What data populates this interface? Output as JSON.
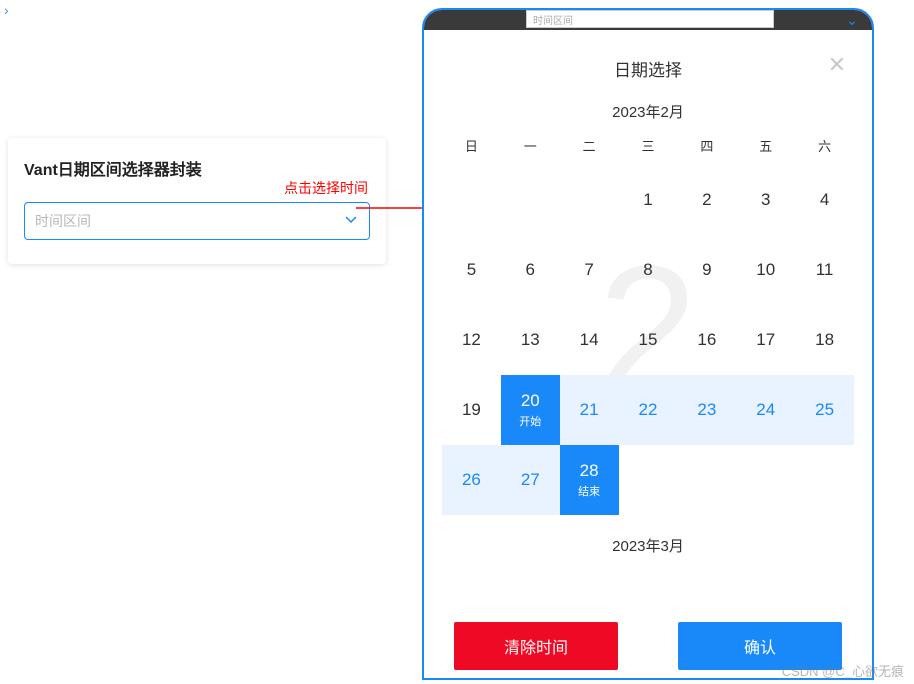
{
  "leftCard": {
    "title": "Vant日期区间选择器封装",
    "inputPlaceholder": "时间区间"
  },
  "annotation": "点击选择时间",
  "darkStrip": {
    "placeholder": "时间区间"
  },
  "calendar": {
    "title": "日期选择",
    "monthLabel": "2023年2月",
    "watermark": "2",
    "weekdays": [
      "日",
      "一",
      "二",
      "三",
      "四",
      "五",
      "六"
    ],
    "days": [
      {
        "n": "",
        "t": "empty"
      },
      {
        "n": "",
        "t": "empty"
      },
      {
        "n": "",
        "t": "empty"
      },
      {
        "n": "1",
        "t": ""
      },
      {
        "n": "2",
        "t": ""
      },
      {
        "n": "3",
        "t": ""
      },
      {
        "n": "4",
        "t": ""
      },
      {
        "n": "5",
        "t": ""
      },
      {
        "n": "6",
        "t": ""
      },
      {
        "n": "7",
        "t": ""
      },
      {
        "n": "8",
        "t": ""
      },
      {
        "n": "9",
        "t": ""
      },
      {
        "n": "10",
        "t": ""
      },
      {
        "n": "11",
        "t": ""
      },
      {
        "n": "12",
        "t": ""
      },
      {
        "n": "13",
        "t": ""
      },
      {
        "n": "14",
        "t": ""
      },
      {
        "n": "15",
        "t": ""
      },
      {
        "n": "16",
        "t": ""
      },
      {
        "n": "17",
        "t": ""
      },
      {
        "n": "18",
        "t": ""
      },
      {
        "n": "19",
        "t": ""
      },
      {
        "n": "20",
        "t": "start",
        "sub": "开始"
      },
      {
        "n": "21",
        "t": "middle"
      },
      {
        "n": "22",
        "t": "middle"
      },
      {
        "n": "23",
        "t": "middle"
      },
      {
        "n": "24",
        "t": "middle"
      },
      {
        "n": "25",
        "t": "middle"
      },
      {
        "n": "26",
        "t": "middle"
      },
      {
        "n": "27",
        "t": "middle"
      },
      {
        "n": "28",
        "t": "end",
        "sub": "结束"
      }
    ],
    "nextMonthLabel": "2023年3月",
    "clearLabel": "清除时间",
    "confirmLabel": "确认"
  },
  "pageWatermark": "CSDN @C_心欲无痕"
}
